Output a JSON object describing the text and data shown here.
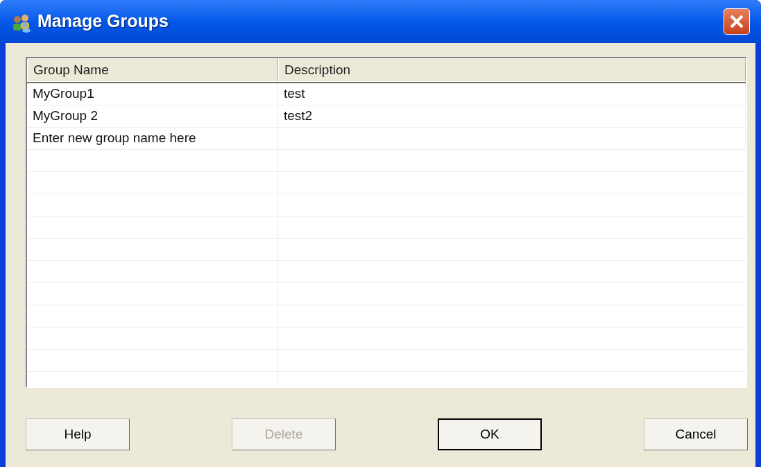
{
  "window": {
    "title": "Manage Groups"
  },
  "table": {
    "columns": [
      "Group Name",
      "Description"
    ],
    "rows": [
      {
        "cells": [
          "MyGroup1",
          "test"
        ]
      },
      {
        "cells": [
          "MyGroup 2",
          "test2"
        ]
      },
      {
        "cells": [
          "Enter new group name here",
          null
        ]
      }
    ]
  },
  "buttons": [
    {
      "label": "Help",
      "disabled": false,
      "default": false
    },
    {
      "label": "Delete",
      "disabled": true,
      "default": false
    },
    {
      "label": "OK",
      "disabled": false,
      "default": true
    },
    {
      "label": "Cancel",
      "disabled": false,
      "default": false
    }
  ]
}
